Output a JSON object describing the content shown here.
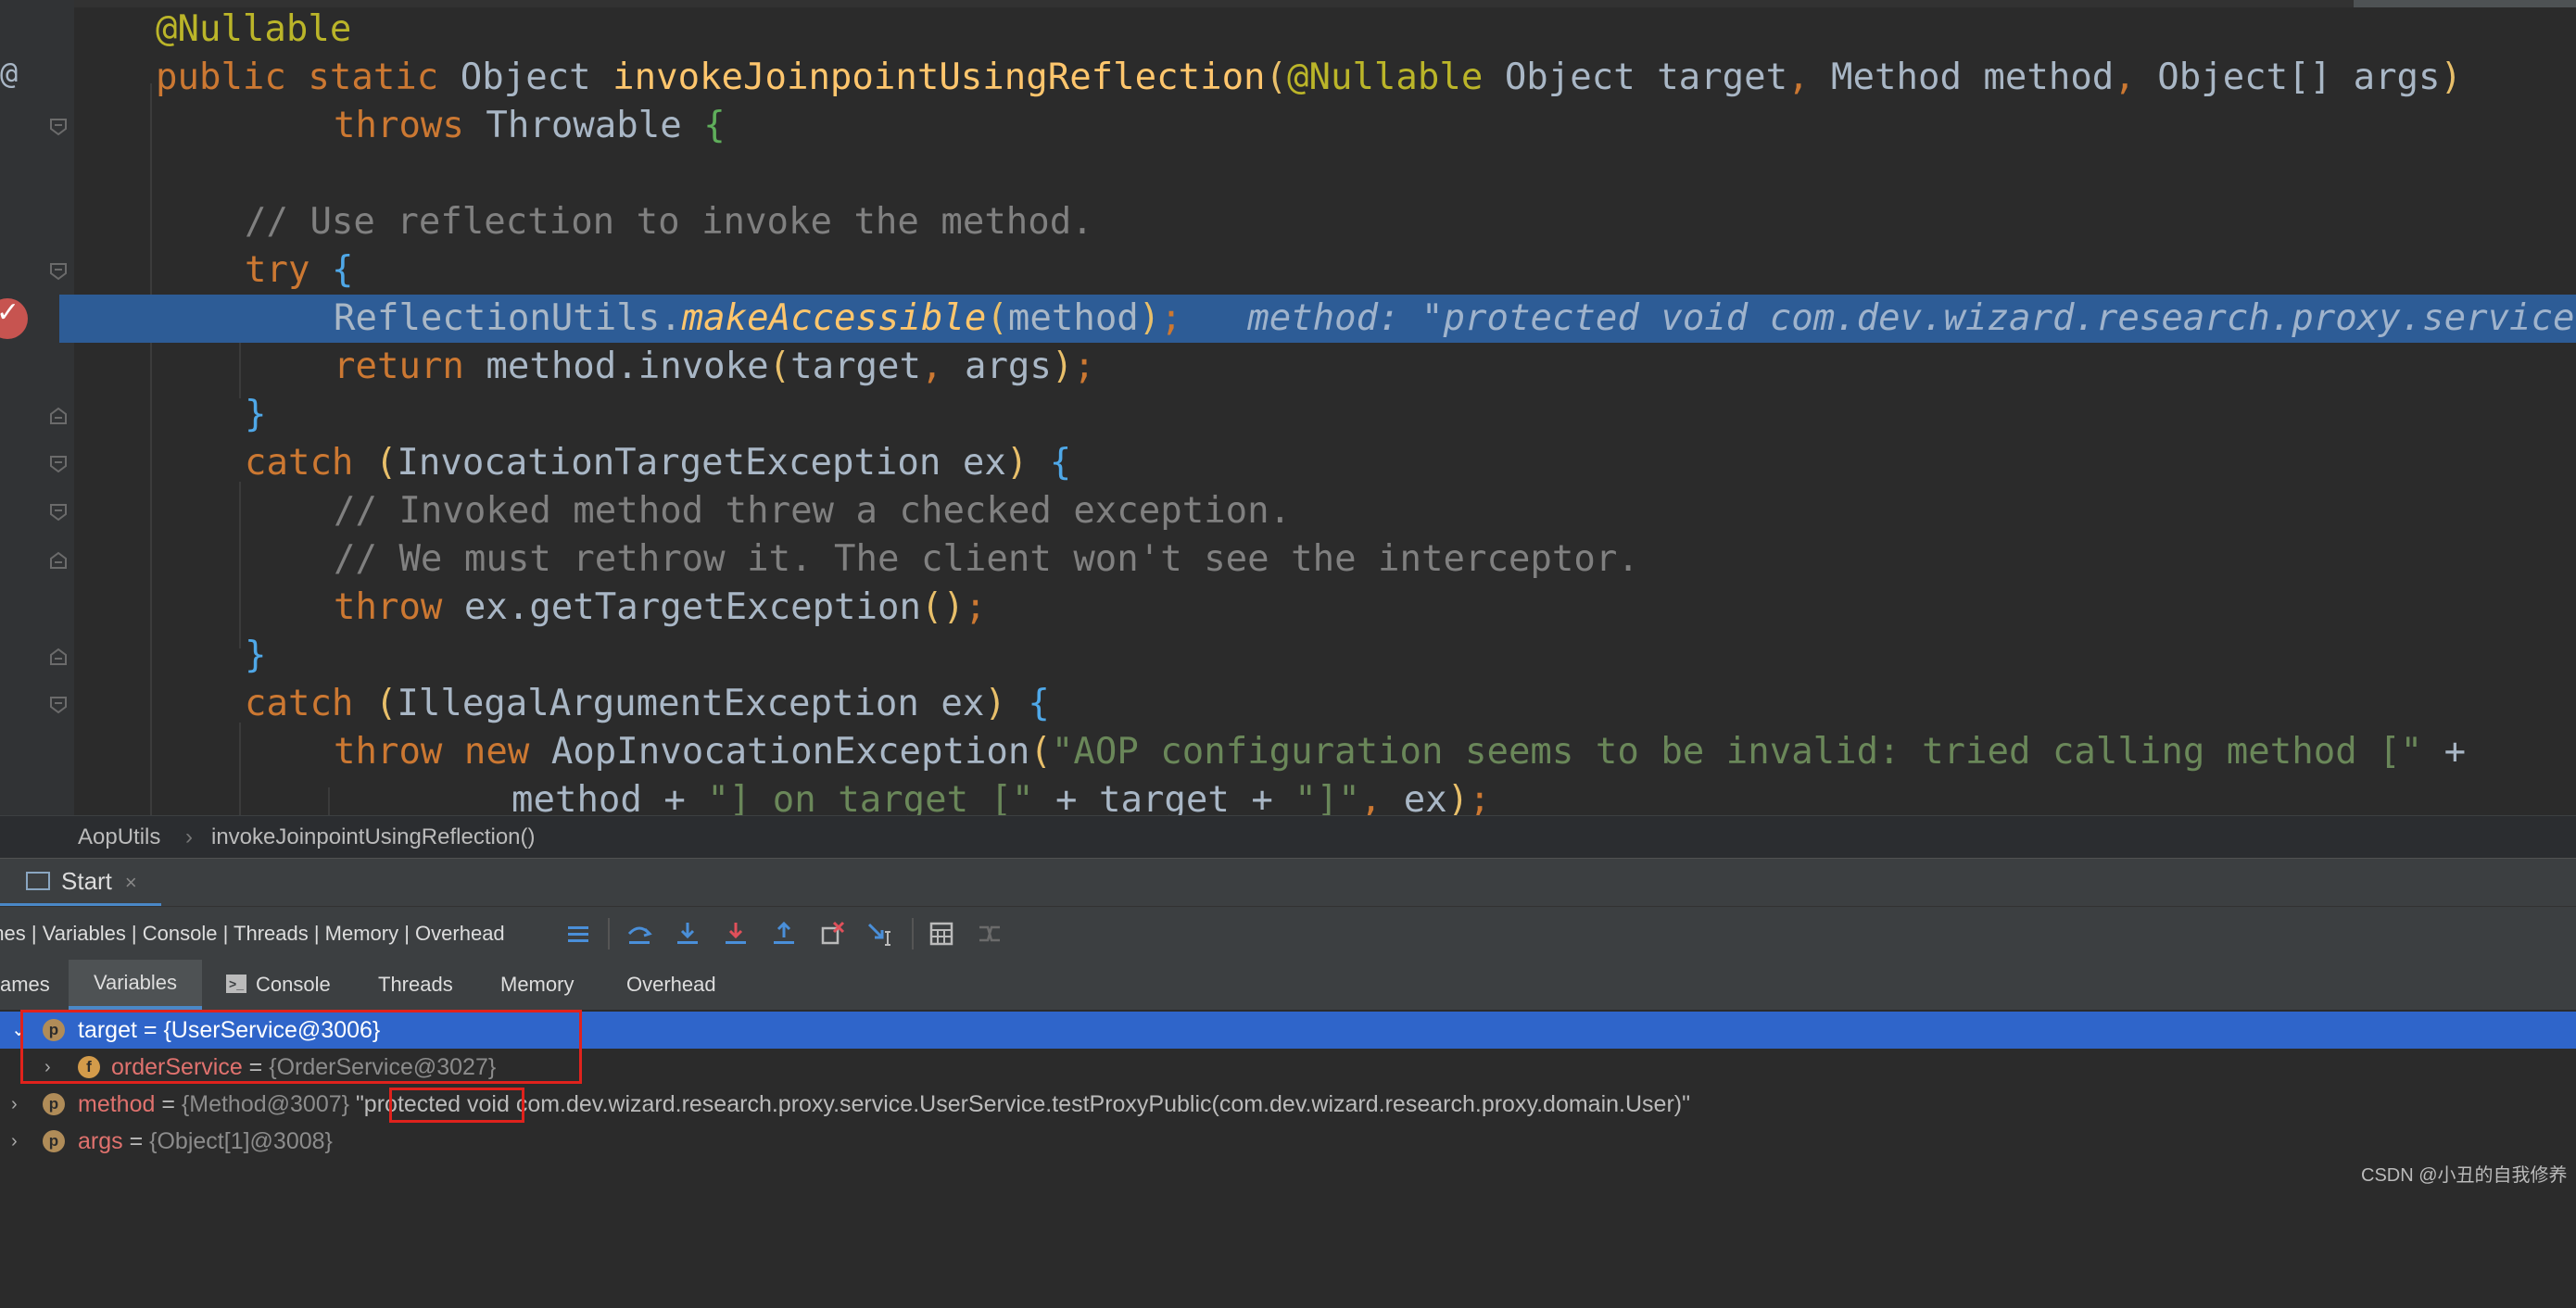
{
  "editor": {
    "gutter_marker": "@",
    "code": {
      "l1": "@Nullable",
      "l2_public": "public",
      "l2_static": "static",
      "l2_obj": "Object",
      "l2_method": "invokeJoinpointUsingReflection",
      "l2_paren_open": "(",
      "l2_ann": "@Nullable",
      "l2_params_1": "Object target",
      "l2_comma": ", ",
      "l2_params_2": "Method method",
      "l2_params_3": "Object[] args",
      "l2_paren_close": ")",
      "l3_throws": "throws",
      "l3_type": "Throwable",
      "l3_brace": "{",
      "l5_comment": "// Use reflection to invoke the method.",
      "l6_try": "try",
      "l6_brace": "{",
      "l7_call": "ReflectionUtils.",
      "l7_method": "makeAccessible",
      "l7_open": "(",
      "l7_arg": "method",
      "l7_close": ")",
      "l7_semi": ";",
      "l7_hint": "method: \"protected void com.dev.wizard.research.proxy.service.UserService.testProxyPublic(com.dev.wizard.research.proxy.domain.User)\"",
      "l8_return": "return",
      "l8_call": "method.invoke",
      "l8_open": "(",
      "l8_args": "target",
      "l8_comma": ", ",
      "l8_args2": "args",
      "l8_close": ")",
      "l8_semi": ";",
      "l9_brace": "}",
      "l10_catch": "catch",
      "l10_open": "(",
      "l10_ex": "InvocationTargetException ex",
      "l10_close": ")",
      "l10_brace": "{",
      "l11_comment": "// Invoked method threw a checked exception.",
      "l12_comment": "// We must rethrow it. The client won't see the interceptor.",
      "l13_throw": "throw",
      "l13_call": "ex.getTargetException",
      "l13_parens": "()",
      "l13_semi": ";",
      "l14_brace": "}",
      "l15_catch": "catch",
      "l15_open": "(",
      "l15_ex": "IllegalArgumentException ex",
      "l15_close": ")",
      "l15_brace": "{",
      "l16_throw": "throw",
      "l16_new": "new",
      "l16_type": "AopInvocationException",
      "l16_open": "(",
      "l16_str": "\"AOP configuration seems to be invalid: tried calling method [\"",
      "l16_plus": " +",
      "l17_a": "method + ",
      "l17_s1": "\"] on target [\"",
      "l17_b": " + target + ",
      "l17_s2": "\"]\"",
      "l17_comma": ", ",
      "l17_ex": "ex",
      "l17_close": ")",
      "l17_semi": ";"
    }
  },
  "breadcrumb": {
    "class": "AopUtils",
    "sep": "›",
    "method": "invokeJoinpointUsingReflection()"
  },
  "debug": {
    "tab_label": "Start",
    "tab_close": "×",
    "layout_label": "ames | Variables | Console | Threads | Memory | Overhead",
    "subtabs": {
      "frames": "ames",
      "variables": "Variables",
      "console": "Console",
      "threads": "Threads",
      "memory": "Memory",
      "overhead": "Overhead"
    },
    "console_icon": ">_"
  },
  "variables": [
    {
      "badge": "p",
      "name": "target",
      "eq": " = ",
      "type": "{UserService@3006}",
      "value": ""
    },
    {
      "badge": "f",
      "name": "orderService",
      "eq": " = ",
      "type": "{OrderService@3027}",
      "value": ""
    },
    {
      "badge": "p",
      "name": "method",
      "eq": " = ",
      "type": "{Method@3007}",
      "value_pre": "\"protected",
      "value_post": " void com.dev.wizard.research.proxy.service.UserService.testProxyPublic(com.dev.wizard.research.proxy.domain.User)\""
    },
    {
      "badge": "p",
      "name": "args",
      "eq": " = ",
      "type": "{Object[1]@3008}",
      "value": ""
    }
  ],
  "watermark": "CSDN @小丑的自我修养"
}
